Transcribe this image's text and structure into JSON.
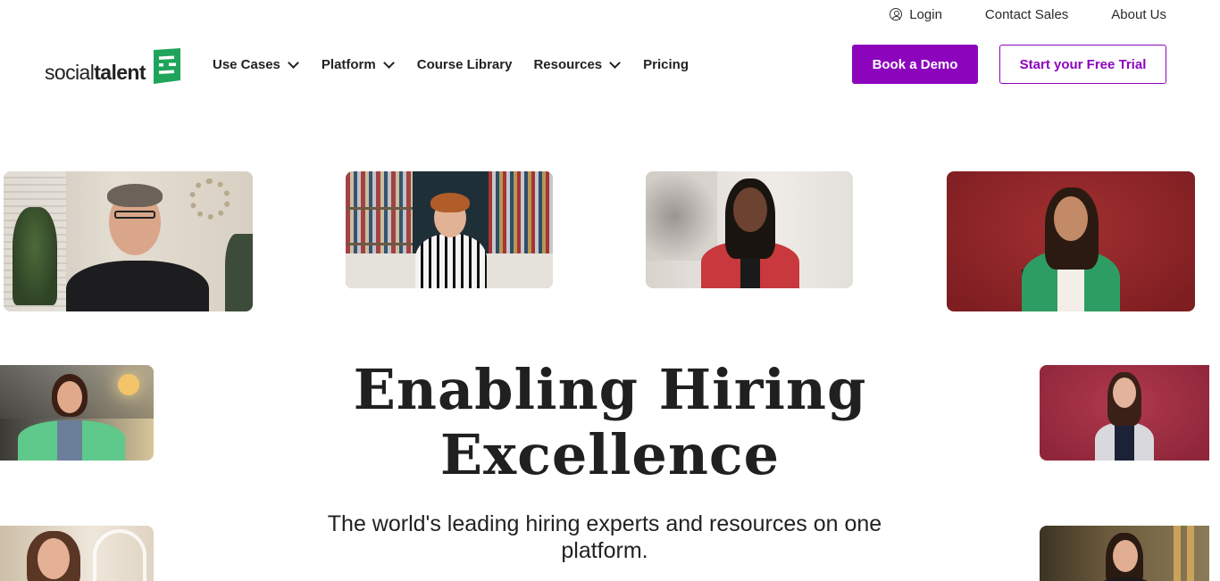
{
  "utility_nav": {
    "login": "Login",
    "contact_sales": "Contact Sales",
    "about_us": "About Us"
  },
  "logo": {
    "text_light": "social",
    "text_bold": "talent"
  },
  "main_nav": {
    "use_cases": "Use Cases",
    "platform": "Platform",
    "course_library": "Course Library",
    "resources": "Resources",
    "pricing": "Pricing"
  },
  "cta": {
    "book_demo": "Book a Demo",
    "free_trial": "Start your Free Trial"
  },
  "hero": {
    "title_line1": "Enabling Hiring",
    "title_line2": "Excellence",
    "subtitle": "The world's leading hiring experts and resources on one platform."
  },
  "colors": {
    "brand_purple": "#8c05bd",
    "logo_green": "#1fa55b",
    "text_dark": "#202020"
  },
  "icons": [
    "user-circle-icon",
    "chevron-down-icon",
    "social-talent-logo-mark"
  ]
}
